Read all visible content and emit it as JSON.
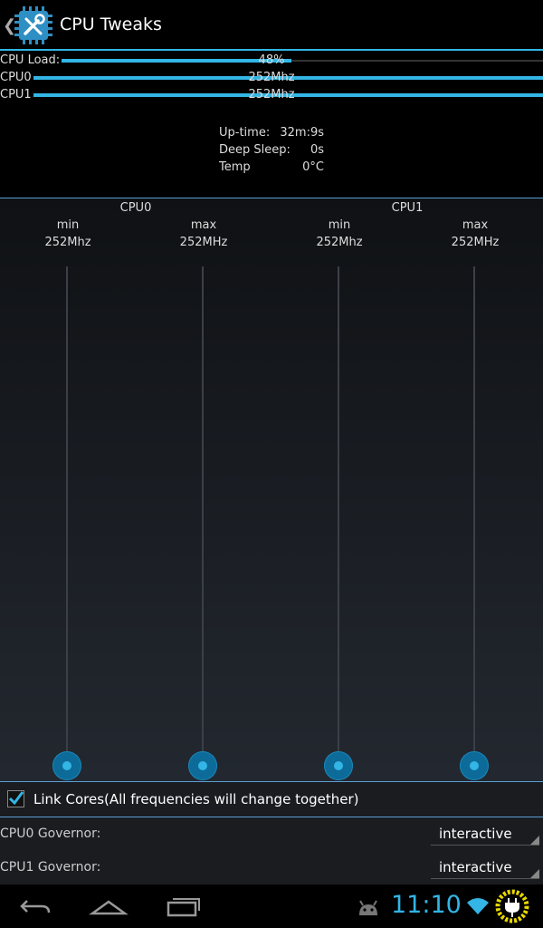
{
  "app": {
    "title": "CPU Tweaks"
  },
  "stats": {
    "cpu_load": {
      "label": "CPU Load:",
      "value": "48%",
      "fraction": 0.48
    },
    "cpu0": {
      "label": "CPU0",
      "value": "252Mhz",
      "fraction": 1.0
    },
    "cpu1": {
      "label": "CPU1",
      "value": "252Mhz",
      "fraction": 1.0
    }
  },
  "info": {
    "uptime_label": "Up-time:",
    "uptime_value": "32m:9s",
    "deepsleep_label": "Deep Sleep:",
    "deepsleep_value": "0s",
    "temp_label": "Temp",
    "temp_value": "0°C"
  },
  "sliders": {
    "cpu0": {
      "title": "CPU0",
      "min": {
        "label": "min",
        "value": "252Mhz",
        "level": 0
      },
      "max": {
        "label": "max",
        "value": "252MHz",
        "level": 0
      }
    },
    "cpu1": {
      "title": "CPU1",
      "min": {
        "label": "min",
        "value": "252Mhz",
        "level": 0
      },
      "max": {
        "label": "max",
        "value": "252MHz",
        "level": 0
      }
    }
  },
  "link_cores": {
    "label": "Link Cores(All frequencies will change together)",
    "checked": true
  },
  "governors": {
    "cpu0": {
      "label": "CPU0 Governor:",
      "value": "interactive"
    },
    "cpu1": {
      "label": "CPU1 Governor:",
      "value": "interactive"
    }
  },
  "statusbar": {
    "time": "11:10"
  },
  "colors": {
    "accent": "#33b5e5",
    "knob": "#0d6b99",
    "clock": "#33b5e5"
  },
  "icons": [
    "up-caret-icon",
    "cpu-tweaks-app-icon",
    "checkbox-checked-icon",
    "spinner-triangle-icon",
    "back-icon",
    "home-icon",
    "recent-apps-icon",
    "android-debug-icon",
    "wifi-icon",
    "battery-charging-icon"
  ]
}
